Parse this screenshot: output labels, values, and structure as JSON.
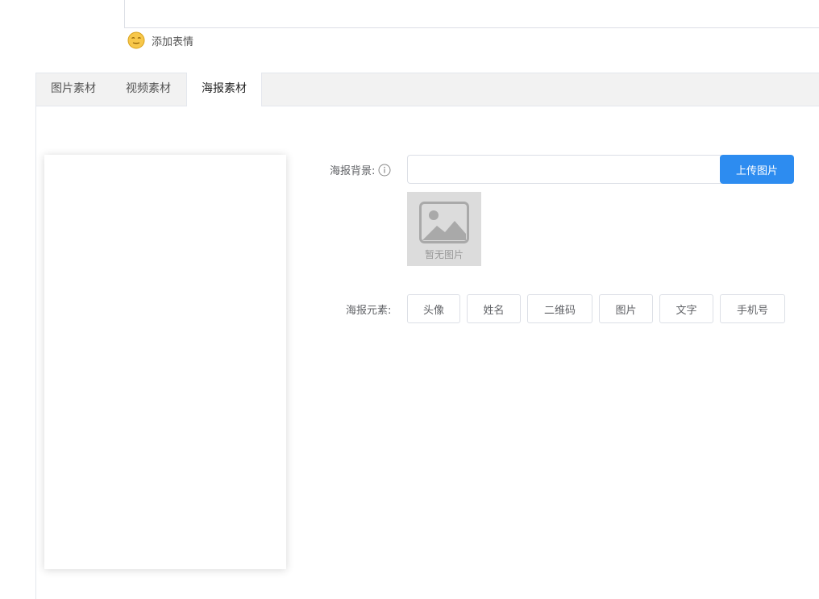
{
  "emoji": {
    "label": "添加表情",
    "icon": "smiley-face-icon"
  },
  "tabs": [
    {
      "label": "图片素材",
      "active": false
    },
    {
      "label": "视频素材",
      "active": false
    },
    {
      "label": "海报素材",
      "active": true
    }
  ],
  "form": {
    "background_label": "海报背景:",
    "background_value": "",
    "upload_label": "上传图片",
    "no_image_text": "暂无图片",
    "elements_label": "海报元素:",
    "elements": [
      "头像",
      "姓名",
      "二维码",
      "图片",
      "文字",
      "手机号"
    ]
  },
  "colors": {
    "primary": "#2d8cf0",
    "tab_bar": "#f2f2f2",
    "placeholder_bg": "#dcdcdc"
  }
}
